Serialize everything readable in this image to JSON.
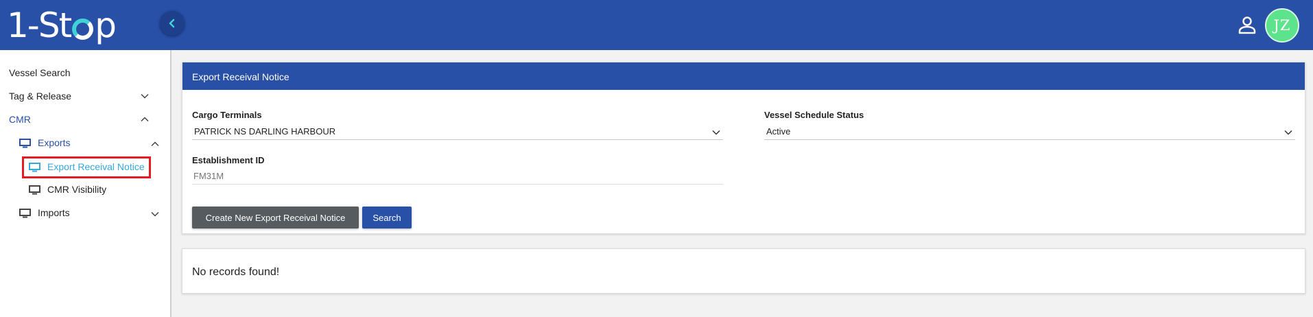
{
  "header": {
    "logo_text_left": "1-St",
    "logo_text_right": "p",
    "avatar_initials": "JZ",
    "colors": {
      "header_bg": "#2850a7",
      "avatar_bg": "#5ce38c",
      "logo_accent": "#3fd3d8"
    }
  },
  "sidebar": {
    "items": [
      {
        "label": "Vessel Search"
      },
      {
        "label": "Tag & Release",
        "expanded": false
      },
      {
        "label": "CMR",
        "expanded": true
      },
      {
        "label": "Exports",
        "expanded": true,
        "icon": "monitor-icon"
      },
      {
        "label": "Export Receival Notice",
        "selected": true,
        "icon": "monitor-icon"
      },
      {
        "label": "CMR Visibility",
        "icon": "monitor-icon"
      },
      {
        "label": "Imports",
        "expanded": false,
        "icon": "monitor-icon"
      }
    ],
    "highlight_color": "#e41b23"
  },
  "panel": {
    "title": "Export Receival Notice",
    "cargo_terminals_label": "Cargo Terminals",
    "cargo_terminals_value": "PATRICK NS DARLING HARBOUR",
    "vessel_status_label": "Vessel Schedule Status",
    "vessel_status_value": "Active",
    "establishment_label": "Establishment ID",
    "establishment_placeholder": "FM31M",
    "create_button": "Create New Export Receival Notice",
    "search_button": "Search"
  },
  "results": {
    "message": "No records found!"
  }
}
